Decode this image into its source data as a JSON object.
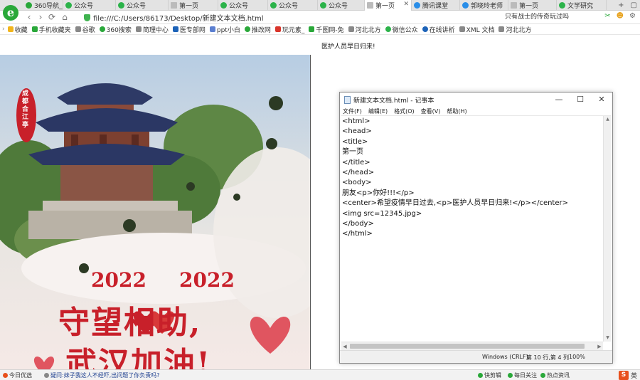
{
  "browser": {
    "tabs": [
      {
        "label": "360导航_",
        "active": false
      },
      {
        "label": "公众号",
        "active": false
      },
      {
        "label": "公众号",
        "active": false
      },
      {
        "label": "第一页",
        "active": false
      },
      {
        "label": "公众号",
        "active": false
      },
      {
        "label": "公众号",
        "active": false
      },
      {
        "label": "公众号",
        "active": false
      },
      {
        "label": "第一页",
        "active": true
      },
      {
        "label": "腾讯课堂",
        "active": false
      },
      {
        "label": "郭晓玲老师",
        "active": false
      },
      {
        "label": "第一页",
        "active": false
      },
      {
        "label": "文学研究",
        "active": false
      }
    ],
    "new_tab": "+",
    "url": "file:///C:/Users/86173/Desktop/新建文本文档.html",
    "search_text": "只有战士的传奇玩过吗",
    "bookmarks": [
      "收藏",
      "手机收藏夹",
      "谷歌",
      "360搜索",
      "简理中心",
      "医专部网",
      "ppt小白",
      "推改网",
      "玩元素_",
      "千图网-免",
      "河北北方",
      "微信公众",
      "在线讲析",
      "XML 文档",
      "河北北方"
    ]
  },
  "page": {
    "paragraph": "医护人员早日归来!",
    "poster": {
      "seal": "成都合江亭",
      "year": "2022",
      "headline1": "守望相助,",
      "headline2": "武汉加油!"
    }
  },
  "notepad": {
    "title": "新建文本文档.html - 记事本",
    "controls": {
      "minimize": "—",
      "maximize": "☐",
      "close": "✕"
    },
    "menu": [
      "文件(F)",
      "编辑(E)",
      "格式(O)",
      "查看(V)",
      "帮助(H)"
    ],
    "content": "<html>\n<head>\n<title>\n第一页\n</title>\n</head>\n<body>\n朋友<p>你好!!!</p>\n<center>希望疫情早日过去,<p>医护人员早日归来!</p></center>\n<img src=12345.jpg>\n</body>\n</html>",
    "status": {
      "encoding": "Windows (CRLF)",
      "position": "第 10 行,第 4 列",
      "zoom": "100%"
    }
  },
  "statusbar": {
    "left_label": "今日优选",
    "news": "疑问:妹子我这人不经吓,出问题了你负责吗?",
    "items": [
      "快剪辑",
      "每日关注",
      "热点资讯"
    ],
    "ime_label": "S",
    "ime_mode": "英"
  },
  "colors": {
    "tab_bg": "#e3e3e3",
    "poster_red": "#c8202a",
    "ime_orange": "#e8501c"
  }
}
